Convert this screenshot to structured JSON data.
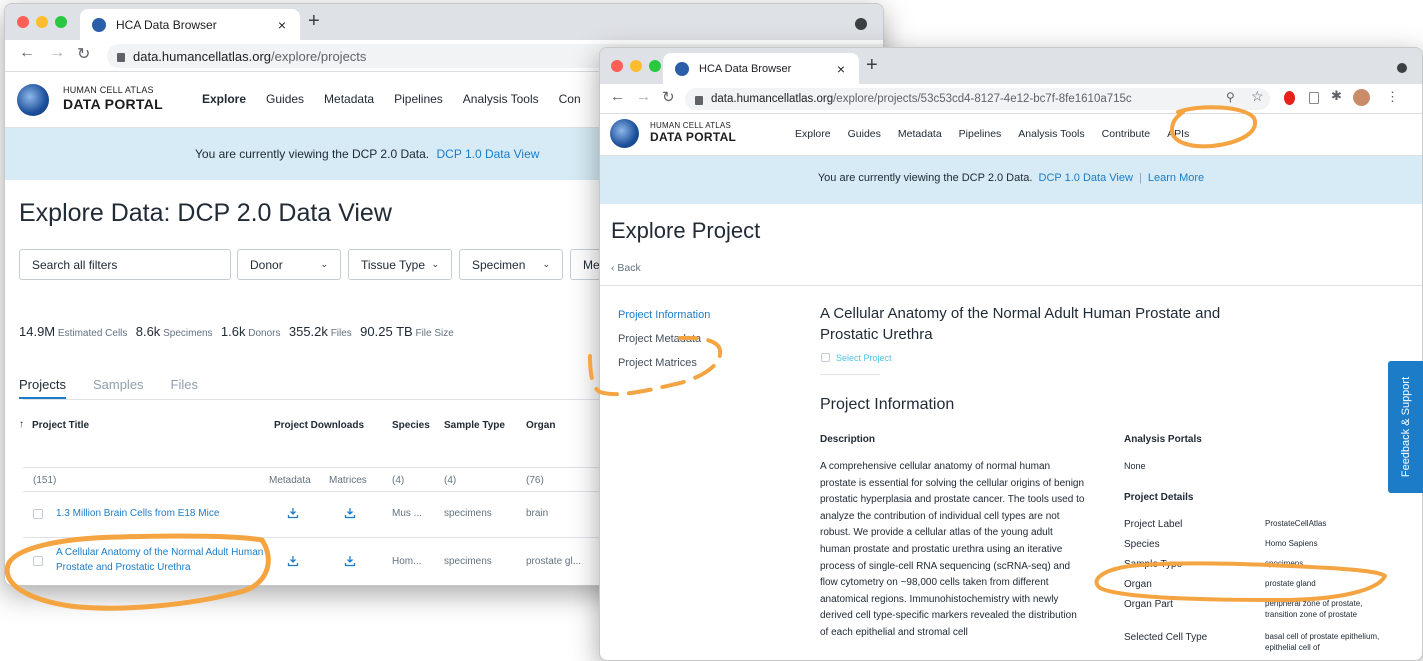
{
  "back_window": {
    "tab_title": "HCA Data Browser",
    "url_domain": "data.humancellatlas.org",
    "url_path": "/explore/projects",
    "logo_line1": "HUMAN CELL ATLAS",
    "logo_line2": "DATA PORTAL",
    "nav": [
      "Explore",
      "Guides",
      "Metadata",
      "Pipelines",
      "Analysis Tools",
      "Con"
    ],
    "banner_text": "You are currently viewing the DCP 2.0 Data.",
    "banner_link": "DCP 1.0 Data View",
    "title": "Explore Data: DCP 2.0 Data View",
    "search_placeholder": "Search all filters",
    "filters": [
      "Donor",
      "Tissue Type",
      "Specimen",
      "Me"
    ],
    "stats": [
      {
        "value": "14.9M",
        "label": "Estimated Cells"
      },
      {
        "value": "8.6k",
        "label": "Specimens"
      },
      {
        "value": "1.6k",
        "label": "Donors"
      },
      {
        "value": "355.2k",
        "label": "Files"
      },
      {
        "value": "90.25 TB",
        "label": "File Size"
      }
    ],
    "tabs": [
      "Projects",
      "Samples",
      "Files"
    ],
    "columns": {
      "title": "Project Title",
      "downloads": "Project Downloads",
      "species": "Species",
      "sample_type": "Sample Type",
      "organ": "Organ"
    },
    "counts": {
      "title": "(151)",
      "metadata": "Metadata",
      "matrices": "Matrices",
      "species": "(4)",
      "sample_type": "(4)",
      "organ": "(76)"
    },
    "rows": [
      {
        "title": "1.3 Million Brain Cells from E18 Mice",
        "species": "Mus ...",
        "sample_type": "specimens",
        "organ": "brain"
      },
      {
        "title": "A Cellular Anatomy of the Normal Adult Human Prostate and Prostatic Urethra",
        "species": "Hom...",
        "sample_type": "specimens",
        "organ": "prostate gl..."
      }
    ]
  },
  "front_window": {
    "tab_title": "HCA Data Browser",
    "url_domain": "data.humancellatlas.org",
    "url_path": "/explore/projects/53c53cd4-8127-4e12-bc7f-8fe1610a715c",
    "logo_line1": "HUMAN CELL ATLAS",
    "logo_line2": "DATA PORTAL",
    "nav": [
      "Explore",
      "Guides",
      "Metadata",
      "Pipelines",
      "Analysis Tools",
      "Contribute",
      "APIs"
    ],
    "banner_text": "You are currently viewing the DCP 2.0 Data.",
    "banner_link1": "DCP 1.0 Data View",
    "banner_sep": "|",
    "banner_link2": "Learn More",
    "title": "Explore Project",
    "back": "‹ Back",
    "side_nav": [
      "Project Information",
      "Project Metadata",
      "Project Matrices"
    ],
    "project_title": "A Cellular Anatomy of the Normal Adult Human Prostate and Prostatic Urethra",
    "select_project": "Select Project",
    "section_heading": "Project Information",
    "description_label": "Description",
    "description": "A comprehensive cellular anatomy of normal human prostate is essential for solving the cellular origins of benign prostatic hyperplasia and prostate cancer. The tools used to analyze the contribution of individual cell types are not robust. We provide a cellular atlas of the young adult human prostate and prostatic urethra using an iterative process of single-cell RNA sequencing (scRNA-seq) and flow cytometry on ~98,000 cells taken from different anatomical regions. Immunohistochemistry with newly derived cell type-specific markers revealed the distribution of each epithelial and stromal cell",
    "analysis_portals_label": "Analysis Portals",
    "analysis_portals_value": "None",
    "project_details_label": "Project Details",
    "details": [
      {
        "key": "Project Label",
        "value": "ProstateCellAtlas"
      },
      {
        "key": "Species",
        "value": "Homo Sapiens"
      },
      {
        "key": "Sample Type",
        "value": "specimens"
      },
      {
        "key": "Organ",
        "value": "prostate gland"
      },
      {
        "key": "Organ Part",
        "value": "peripheral zone of prostate, transition zone of prostate"
      },
      {
        "key": "Selected Cell Type",
        "value": "basal cell of prostate epithelium, epithelial cell of"
      }
    ]
  },
  "feedback": "Feedback & Support",
  "colors": {
    "link": "#1c7cc7",
    "banner": "#d6ebf5",
    "annotation": "#f5a442",
    "feedback": "#1c7cc7"
  }
}
